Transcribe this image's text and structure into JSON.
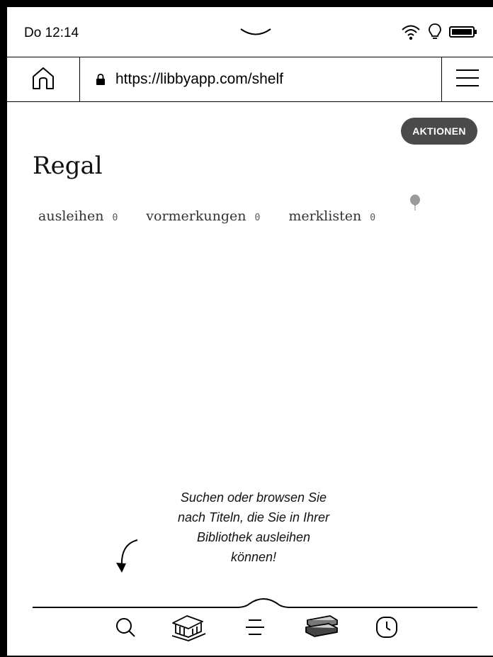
{
  "status": {
    "time": "Do 12:14",
    "icons": [
      "wifi-icon",
      "lightbulb-icon",
      "battery-icon"
    ]
  },
  "browser": {
    "url": "https://libbyapp.com/shelf"
  },
  "shelf": {
    "actions_label": "AKTIONEN",
    "title": "Regal",
    "tabs": [
      {
        "label": "ausleihen",
        "count": "0"
      },
      {
        "label": "vormerkungen",
        "count": "0"
      },
      {
        "label": "merklisten",
        "count": "0"
      }
    ],
    "hint_lines": [
      "Suchen oder browsen Sie",
      "nach Titeln, die Sie in Ihrer",
      "Bibliothek ausleihen",
      "können!"
    ]
  },
  "bottom_nav": {
    "items": [
      "search-icon",
      "library-icon",
      "menu-icon",
      "shelf-books-icon",
      "timeline-clock-icon"
    ]
  },
  "colors": {
    "button_bg": "#4a4a4a",
    "text": "#111111",
    "muted": "#555555"
  }
}
